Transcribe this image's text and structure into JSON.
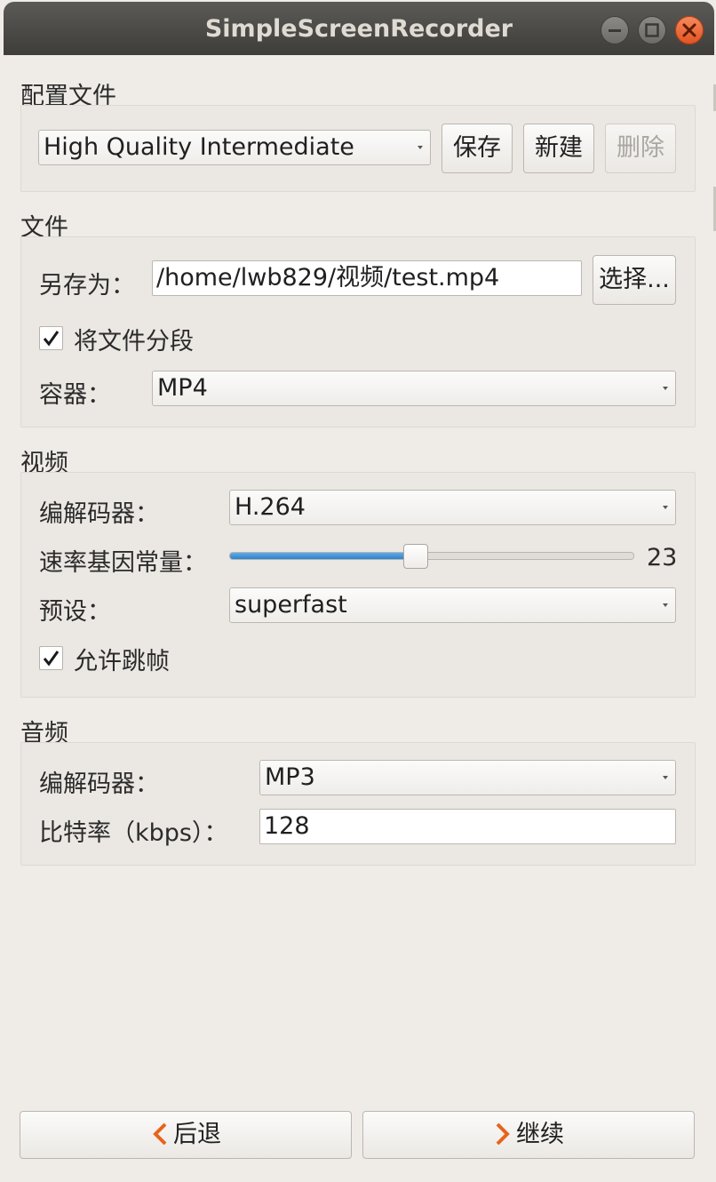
{
  "window": {
    "title": "SimpleScreenRecorder"
  },
  "profile": {
    "section_label": "配置文件",
    "selected": "High Quality Intermediate",
    "save_label": "保存",
    "new_label": "新建",
    "delete_label": "删除"
  },
  "file": {
    "section_label": "文件",
    "save_as_label": "另存为：",
    "save_as_value": "/home/lwb829/视频/test.mp4",
    "browse_label": "选择...",
    "split_label": "将文件分段",
    "split_checked": true,
    "container_label": "容器：",
    "container_value": "MP4"
  },
  "video": {
    "section_label": "视频",
    "codec_label": "编解码器：",
    "codec_value": "H.264",
    "crf_label": "速率基因常量：",
    "crf_value": "23",
    "crf_fraction": 0.46,
    "preset_label": "预设：",
    "preset_value": "superfast",
    "skip_label": "允许跳帧",
    "skip_checked": true
  },
  "audio": {
    "section_label": "音频",
    "codec_label": "编解码器：",
    "codec_value": "MP3",
    "bitrate_label": "比特率（kbps）：",
    "bitrate_value": "128"
  },
  "footer": {
    "back_label": "后退",
    "continue_label": "继续"
  },
  "colors": {
    "slider_fill": "#3b8fd6",
    "nav_arrow": "#e8631b",
    "close_button": "#e65a25"
  }
}
